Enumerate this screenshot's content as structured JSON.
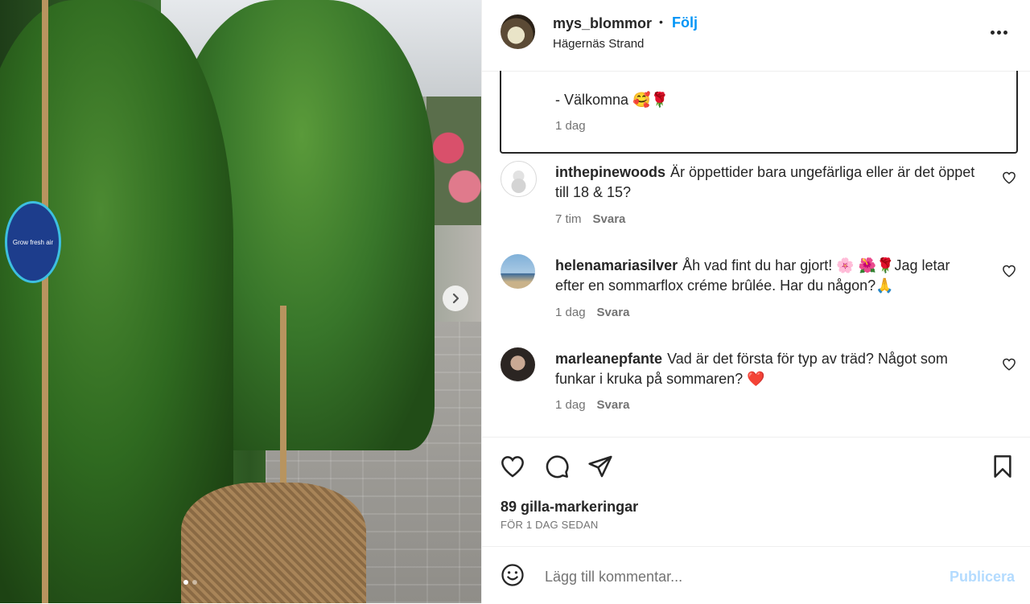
{
  "post": {
    "username": "mys_blommor",
    "separator": "•",
    "follow_label": "Följ",
    "location": "Hägernäs Strand",
    "caption": {
      "text": "- Välkomna 🥰🌹",
      "time": "1 dag"
    },
    "image_tag_text": "Grow fresh air"
  },
  "comments": [
    {
      "username": "inthepinewoods",
      "text": "Är öppettider bara ungefärliga eller är det öppet till 18 & 15?",
      "time": "7 tim",
      "reply_label": "Svara"
    },
    {
      "username": "helenamariasilver",
      "text": "Åh vad fint du har gjort! 🌸 🌺🌹Jag letar efter en sommarflox créme brûlée. Har du någon?🙏",
      "time": "1 dag",
      "reply_label": "Svara"
    },
    {
      "username": "marleanepfante",
      "text": "Vad är det första för typ av träd? Något som funkar i kruka på sommaren? ❤️",
      "time": "1 dag",
      "reply_label": "Svara"
    }
  ],
  "engagement": {
    "likes": "89 gilla-markeringar",
    "time_ago": "FÖR 1 DAG SEDAN"
  },
  "add_comment": {
    "placeholder": "Lägg till kommentar...",
    "publish_label": "Publicera"
  },
  "carousel": {
    "current_index": 1,
    "total": 2
  },
  "colors": {
    "accent": "#0095f6",
    "publish_disabled": "#b3dbff",
    "text_secondary": "#737373",
    "like_heart": "#ed4956"
  },
  "icons": {
    "next": "chevron-right-icon",
    "like": "heart-icon",
    "comment": "comment-icon",
    "share": "paper-plane-icon",
    "save": "bookmark-icon",
    "more": "more-options-icon",
    "emoji": "smiley-icon"
  }
}
